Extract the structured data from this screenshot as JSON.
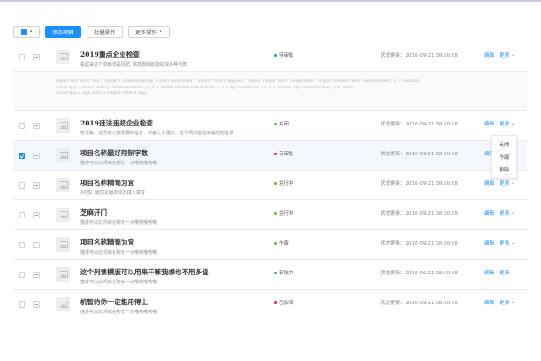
{
  "toolbar": {
    "add_label": "添加项目",
    "batch_label": "批量操作",
    "more_label": "更多操作"
  },
  "status_colors": {
    "pending": "#1890ff",
    "closed": "#52c41a",
    "error": "#f5222d",
    "running": "#52c41a",
    "void": "#52c41a",
    "review": "#1890ff",
    "returned": "#f5222d"
  },
  "rows": [
    {
      "title": "2019重点企业检查",
      "desc": "看起来这个模板很是别扭, 将其删除就能完成多种列表",
      "status": "待审批",
      "updated": "状态更新：2016-09-21  08:50:08",
      "edit": "编辑",
      "more": "更多"
    },
    {
      "title": "2019违法违规企业检查",
      "desc": "暂黑板，这里可以放置要的信息，或者让人展白，这个项内容是平解的的信息",
      "status": "关闭",
      "updated": "状态更新：2016-09-21  08:50:08",
      "edit": "编辑",
      "more": "更多"
    },
    {
      "title": "项目名称最好限制字数",
      "desc": "描述可以比项目名称长一点哦哦哦哦哦",
      "status": "有审批",
      "updated": "状态更新：2016-09-21  08:50:08",
      "edit": "编辑",
      "more": "更多"
    },
    {
      "title": "项目名称精简为宜",
      "desc": "XX部门最优化最简化的接入意客",
      "status": "运行中",
      "updated": "状态更新：2016-09-21  08:50:08",
      "edit": "编辑",
      "more": "更多"
    },
    {
      "title": "芝麻开门",
      "desc": "描述可以比项目名称长一点哦哦哦哦哦",
      "status": "运行中",
      "updated": "状态更新：2016-09-21  08:50:08",
      "edit": "编辑",
      "more": "更多"
    },
    {
      "title": "项目名称精简为宜",
      "desc": "描述可以比项目名称长一点哦哦哦哦哦",
      "status": "作废",
      "updated": "状态更新：2016-09-21  08:50:08",
      "edit": "编辑",
      "more": "更多"
    },
    {
      "title": "这个列表模版可以用来干嘛我想也不用多说",
      "desc": "描述可以比项目名称长一点哦哦哦哦哦",
      "status": "审批中",
      "updated": "状态更新：2016-09-21  08:50:08",
      "edit": "编辑",
      "more": "更多"
    },
    {
      "title": "机智的你一定能用得上",
      "desc": "描述可以比项目名称长一点哦哦哦哦哦",
      "status": "已驳回",
      "updated": "状态更新：2016-09-21  08:50:08",
      "edit": "编辑",
      "more": "更多"
    }
  ],
  "code_lines": [
    "import dva from 'dva'; import { browserHistory } from 'dva/router'; import * from 'App.less'; import router from './web/router'; import models from './web/models'; // 1. Initialize",
    "const app = dva({ history: browserHistory }); // 2. Model models.forEach((m) => { app.model(m); }); // 3. Router app.router(router); // 4. Start",
    "const App = app.start(); export default App;"
  ],
  "dropdown_items": [
    "关闭",
    "作废",
    "删除"
  ]
}
